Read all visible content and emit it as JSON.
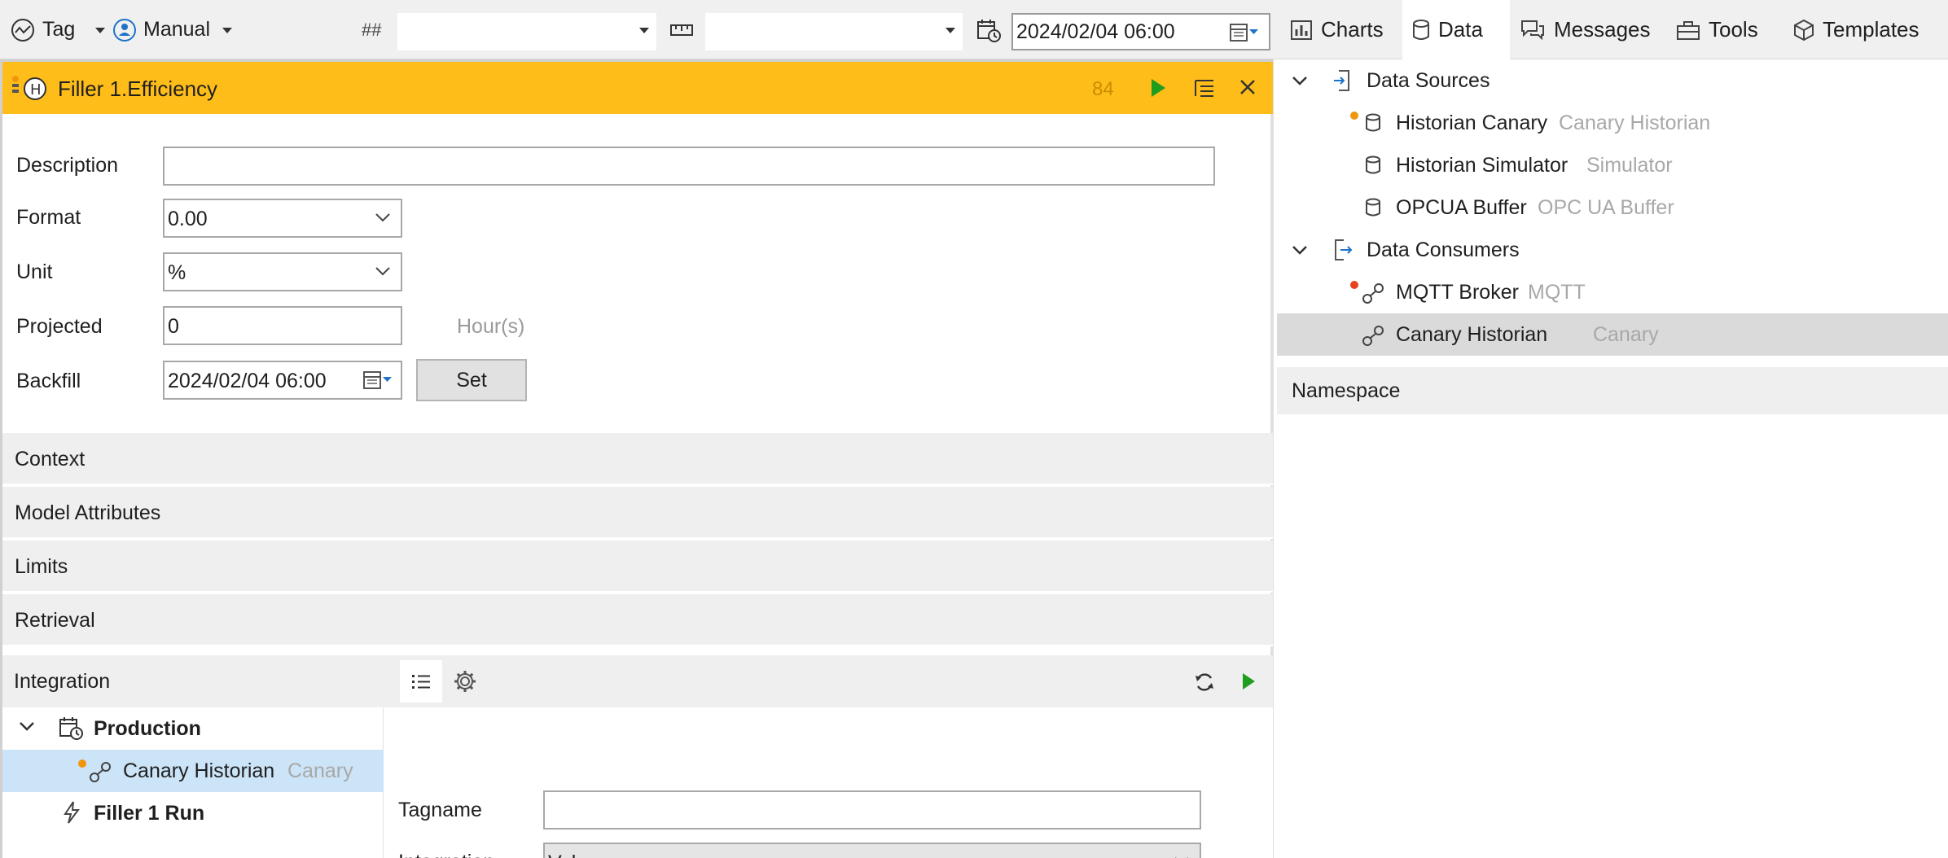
{
  "toolbar": {
    "tag_label": "Tag",
    "mode_label": "Manual",
    "hash_label": "##",
    "combo1_value": "",
    "combo2_value": "",
    "date_value": "2024/02/04 06:00",
    "tabs": [
      {
        "label": "Charts",
        "icon": "bar-chart-icon"
      },
      {
        "label": "Data",
        "icon": "database-icon"
      },
      {
        "label": "Messages",
        "icon": "speech-bubbles-icon"
      },
      {
        "label": "Tools",
        "icon": "toolbox-icon"
      },
      {
        "label": "Templates",
        "icon": "cube-icon"
      }
    ],
    "active_tab": "Data"
  },
  "panel": {
    "title": "Filler 1.Efficiency",
    "count": "84",
    "header_color": "#ffbd19",
    "form": {
      "description_label": "Description",
      "description_value": "",
      "format_label": "Format",
      "format_value": "0.00",
      "unit_label": "Unit",
      "unit_value": "%",
      "projected_label": "Projected",
      "projected_value": "0",
      "projected_unit": "Hour(s)",
      "backfill_label": "Backfill",
      "backfill_value": "2024/02/04 06:00",
      "set_button": "Set"
    },
    "sections": [
      "Context",
      "Model Attributes",
      "Limits",
      "Retrieval"
    ],
    "integration": {
      "label": "Integration",
      "tree": [
        {
          "label": "Production",
          "bold": true,
          "expanded": true
        },
        {
          "label": "Canary Historian",
          "sublabel": "Canary",
          "selected": true
        },
        {
          "label": "Filler 1 Run",
          "bold": true
        }
      ],
      "tagname_label": "Tagname",
      "tagname_value": "",
      "integration_label": "Integration",
      "integration_value": "Values"
    }
  },
  "right": {
    "sources_label": "Data Sources",
    "sources": [
      {
        "name": "Historian Canary",
        "type": "Canary Historian",
        "status": "orange"
      },
      {
        "name": "Historian Simulator",
        "type": "Simulator"
      },
      {
        "name": "OPCUA Buffer",
        "type": "OPC UA Buffer"
      }
    ],
    "consumers_label": "Data Consumers",
    "consumers": [
      {
        "name": "MQTT Broker",
        "type": "MQTT",
        "status": "red"
      },
      {
        "name": "Canary Historian",
        "type": "Canary",
        "selected": true
      }
    ],
    "namespace_label": "Namespace"
  },
  "colors": {
    "accent_yellow": "#ffbd19",
    "play_green": "#1f9d1f",
    "status_orange": "#f0960a",
    "status_red": "#e8431f",
    "selection_blue": "#cce4f7",
    "selection_gray": "#dadada"
  }
}
